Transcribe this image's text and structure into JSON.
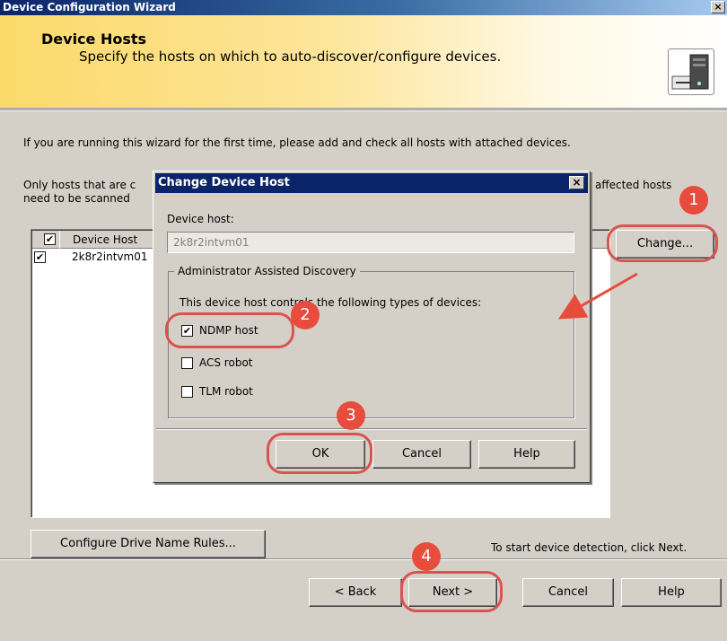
{
  "window": {
    "title": "Device Configuration Wizard",
    "close_glyph": "×"
  },
  "header": {
    "title": "Device Hosts",
    "subtitle": "Specify the hosts on which to auto-discover/configure devices.",
    "icon": "server-icon"
  },
  "body": {
    "intro1": "If you are running this wizard for the first time, please add and check all hosts with attached devices.",
    "intro2_start": "Only hosts that are c",
    "intro2_end": "affected hosts",
    "intro3": "need to be scanned",
    "list": {
      "column_header": "Device Host",
      "rows": [
        {
          "checked": true,
          "label": "2k8r2intvm01"
        }
      ]
    },
    "change_button": "Change...",
    "configure_button": "Configure Drive Name Rules...",
    "start_text": "To start device detection, click Next."
  },
  "footer": {
    "back": "< Back",
    "next": "Next >",
    "cancel": "Cancel",
    "help": "Help"
  },
  "dialog": {
    "title": "Change Device Host",
    "host_label": "Device host:",
    "host_value": "2k8r2intvm01",
    "group_label": "Administrator Assisted Discovery",
    "group_desc": "This device host controls the following types of devices:",
    "options": [
      {
        "label": "NDMP host",
        "checked": true
      },
      {
        "label": "ACS robot",
        "checked": false
      },
      {
        "label": "TLM robot",
        "checked": false
      }
    ],
    "ok": "OK",
    "cancel": "Cancel",
    "help": "Help"
  },
  "annotations": {
    "color": "#e74c3c",
    "steps": [
      "1",
      "2",
      "3",
      "4"
    ]
  }
}
